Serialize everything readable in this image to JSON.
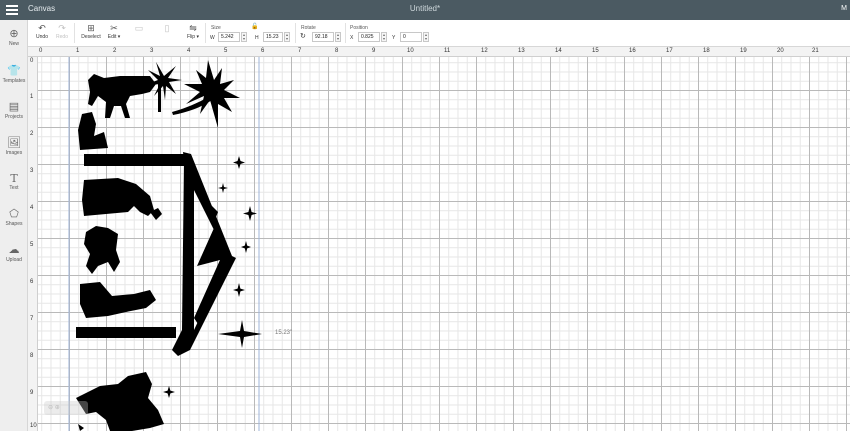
{
  "topbar": {
    "app_name": "Canvas",
    "doc_title": "Untitled*",
    "user_initial": "M"
  },
  "toolbar": {
    "undo": "Undo",
    "redo": "Redo",
    "deselect": "Deselect",
    "edit": "Edit ▾",
    "flip": "Flip ▾",
    "size_label": "Size",
    "w_label": "W",
    "w_value": "5.242",
    "h_label": "H",
    "h_value": "15.23",
    "rotate_label": "Rotate",
    "rotate_value": "92.18",
    "position_label": "Position",
    "x_label": "X",
    "x_value": "0.825",
    "y_label": "Y",
    "y_value": "0"
  },
  "sidebar": {
    "items": [
      {
        "label": "New",
        "icon": "plus-icon"
      },
      {
        "label": "Templates",
        "icon": "shirt-icon"
      },
      {
        "label": "Projects",
        "icon": "projects-icon"
      },
      {
        "label": "Images",
        "icon": "image-icon"
      },
      {
        "label": "Text",
        "icon": "text-icon"
      },
      {
        "label": "Shapes",
        "icon": "shapes-icon"
      },
      {
        "label": "Upload",
        "icon": "cloud-upload-icon"
      }
    ]
  },
  "rulers": {
    "h": [
      "0",
      "1",
      "2",
      "3",
      "4",
      "5",
      "6",
      "7",
      "8",
      "9",
      "10",
      "11",
      "12",
      "13",
      "14",
      "15",
      "16",
      "17",
      "18",
      "19",
      "20",
      "21"
    ],
    "v": [
      "0",
      "1",
      "2",
      "3",
      "4",
      "5",
      "6",
      "7",
      "8",
      "9",
      "10"
    ]
  },
  "canvas": {
    "dimension_label": "15.23\""
  },
  "colors": {
    "topbar": "#4b5a62",
    "artwork": "#000000",
    "grid": "#b9b9b9"
  }
}
